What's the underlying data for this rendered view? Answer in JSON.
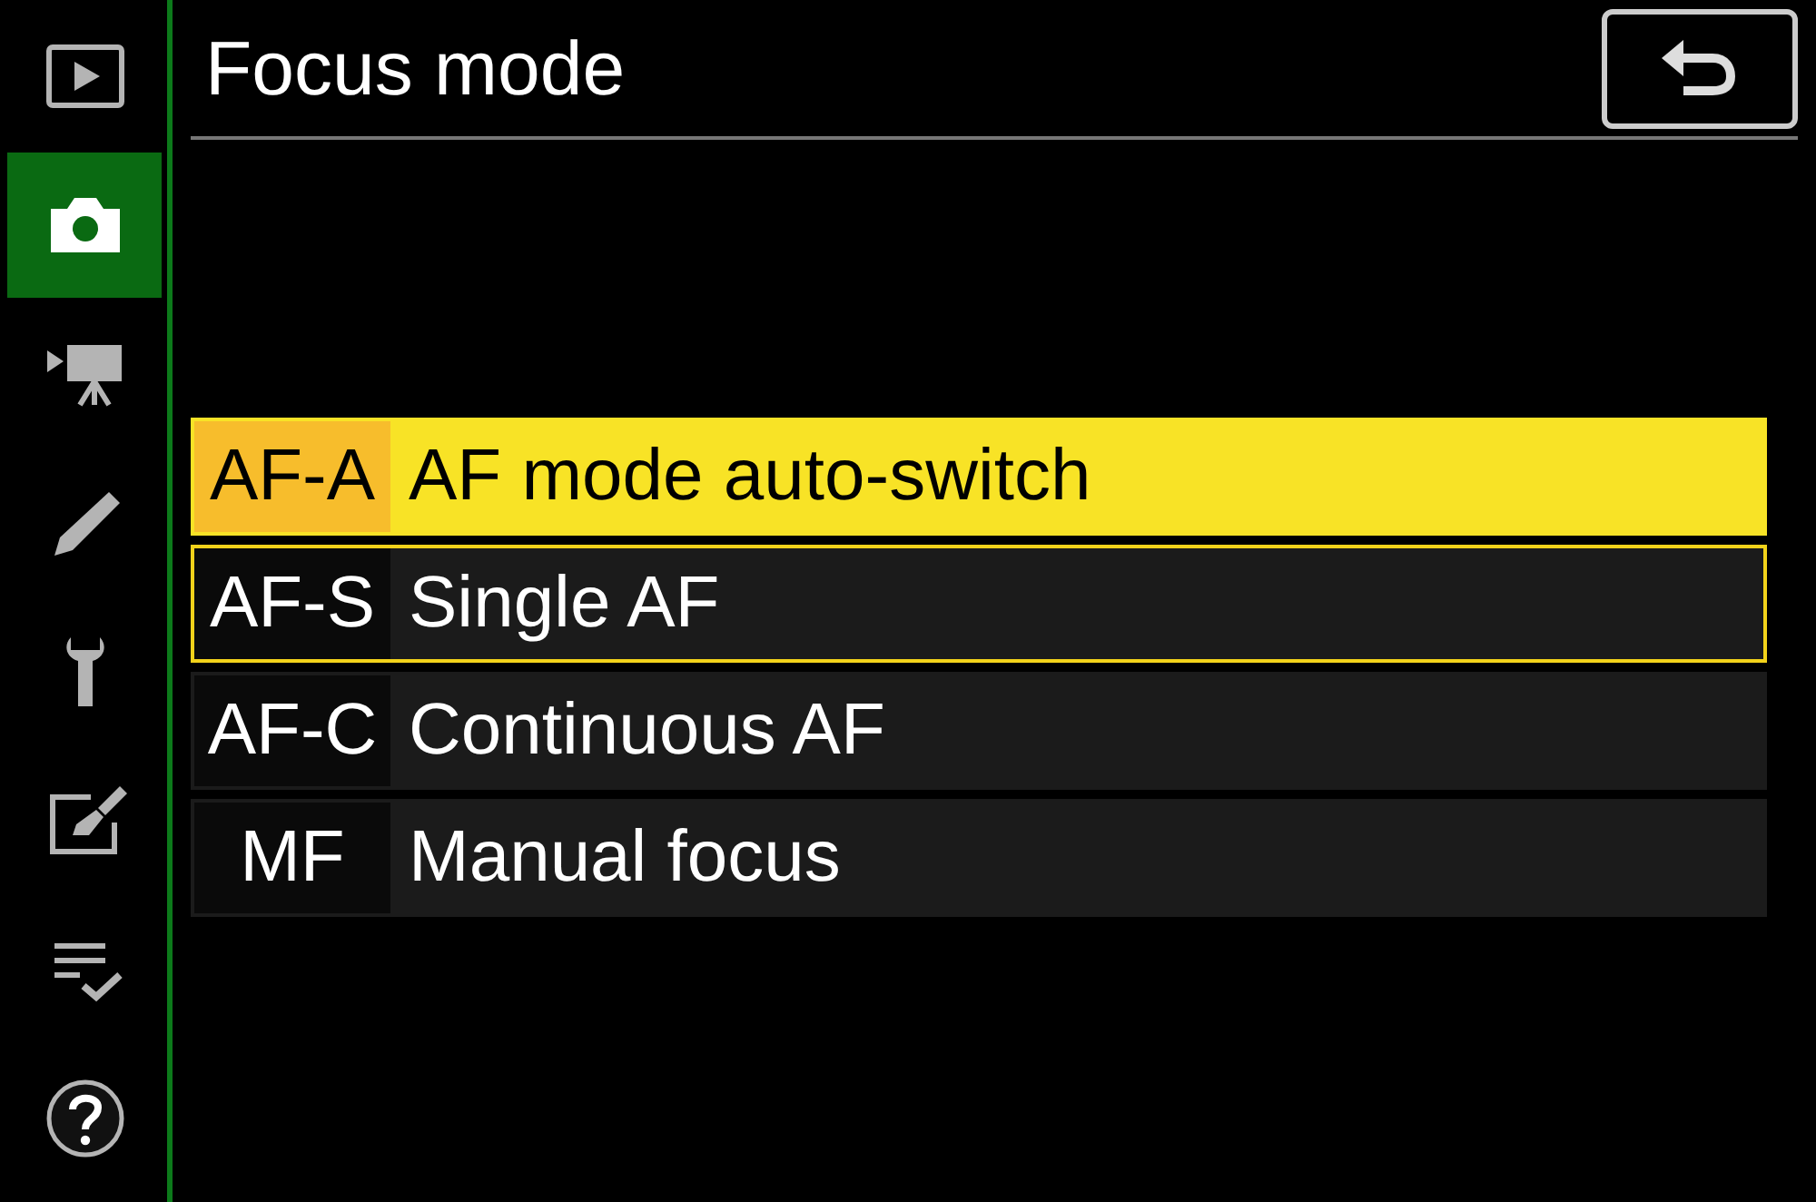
{
  "sidebar": {
    "items": [
      {
        "selected": false
      },
      {
        "selected": true
      },
      {
        "selected": false
      },
      {
        "selected": false
      },
      {
        "selected": false
      },
      {
        "selected": false
      },
      {
        "selected": false
      },
      {
        "selected": false
      }
    ]
  },
  "header": {
    "title": "Focus mode",
    "back_button": true
  },
  "options": [
    {
      "code": "AF-A",
      "label": "AF mode auto-switch",
      "selected": true,
      "current": false
    },
    {
      "code": "AF-S",
      "label": "Single AF",
      "selected": false,
      "current": true
    },
    {
      "code": "AF-C",
      "label": "Continuous AF",
      "selected": false,
      "current": false
    },
    {
      "code": "MF",
      "label": "Manual focus",
      "selected": false,
      "current": false
    }
  ]
}
